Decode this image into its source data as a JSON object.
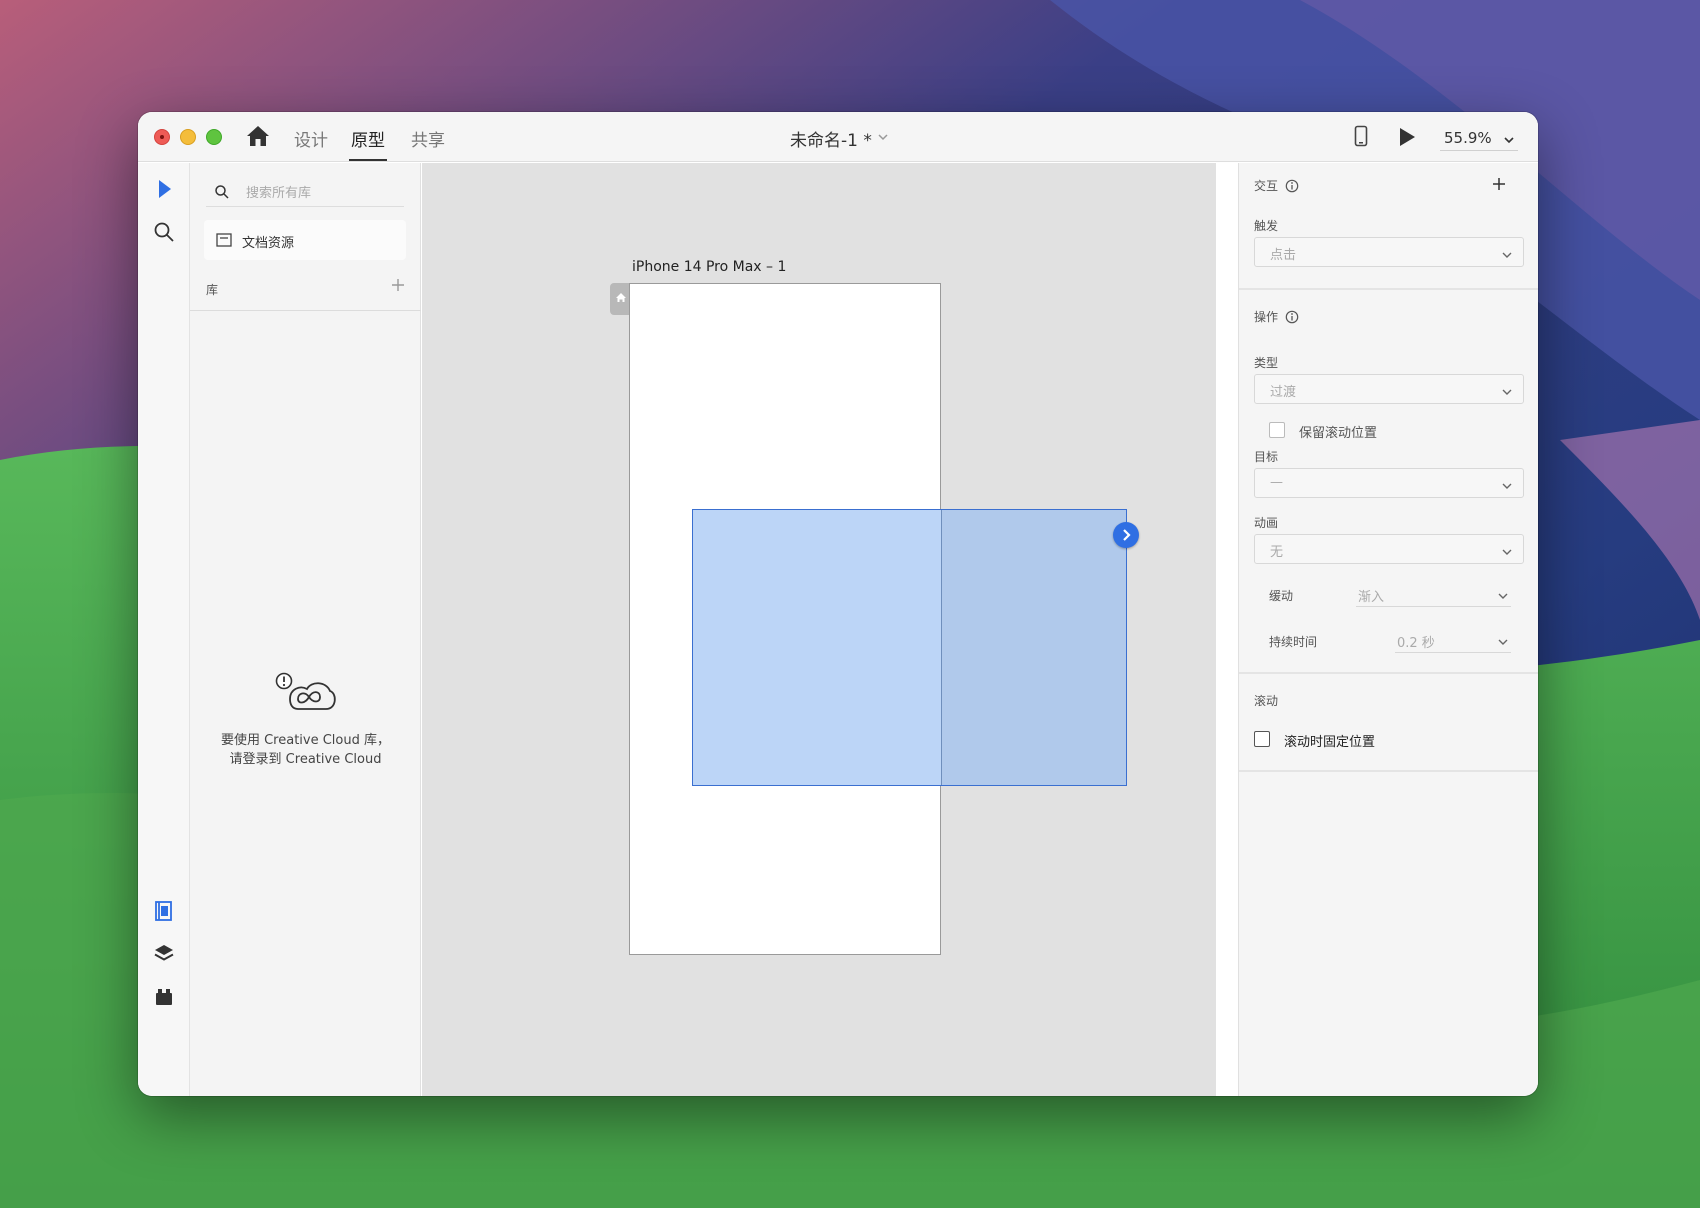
{
  "window": {
    "tabs": [
      "设计",
      "原型",
      "共享"
    ],
    "active_tab": "原型",
    "doc_title": "未命名-1 *",
    "zoom": "55.9%"
  },
  "library": {
    "search_placeholder": "搜索所有库",
    "doc_assets": "文档资源",
    "heading": "库",
    "cc_message_line1": "要使用 Creative Cloud 库，",
    "cc_message_line2": "请登录到 Creative Cloud"
  },
  "canvas": {
    "artboard_name": "iPhone 14 Pro Max – 1"
  },
  "inspector": {
    "interaction": {
      "title": "交互",
      "trigger_label": "触发",
      "trigger_value": "点击"
    },
    "action": {
      "title": "操作",
      "type_label": "类型",
      "type_value": "过渡",
      "preserve_scroll": "保留滚动位置",
      "target_label": "目标",
      "target_value": "—",
      "animation_label": "动画",
      "animation_value": "无",
      "easing_label": "缓动",
      "easing_value": "渐入",
      "duration_label": "持续时间",
      "duration_value": "0.2 秒"
    },
    "scroll": {
      "title": "滚动",
      "fix_position": "滚动时固定位置"
    }
  },
  "colors": {
    "accent": "#2f6fe3",
    "selection_fill": "#bcd5f7",
    "canvas_bg": "#e1e1e1"
  },
  "icons": [
    "home-icon",
    "chevron-down-icon",
    "mobile-device-icon",
    "play-icon",
    "select-arrow-icon",
    "search-icon",
    "document-assets-icon",
    "plus-icon",
    "creative-cloud-alert-icon",
    "libraries-icon",
    "layers-icon",
    "plugins-icon",
    "info-icon",
    "chevron-right-icon"
  ]
}
